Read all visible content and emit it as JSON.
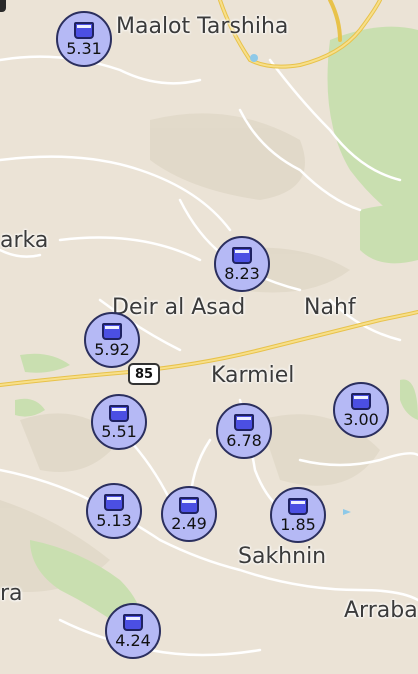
{
  "places": [
    {
      "id": "maalot-tarshiha",
      "text": "Maalot Tarshiha"
    },
    {
      "id": "arka",
      "text": "arka"
    },
    {
      "id": "deir-al-asad",
      "text": "Deir al Asad"
    },
    {
      "id": "nahf",
      "text": "Nahf"
    },
    {
      "id": "karmiel",
      "text": "Karmiel"
    },
    {
      "id": "sakhnin",
      "text": "Sakhnin"
    },
    {
      "id": "ra",
      "text": "ra"
    },
    {
      "id": "arraba",
      "text": "Arraba"
    }
  ],
  "road_shield": {
    "text": "85"
  },
  "markers": [
    {
      "value": "5.31"
    },
    {
      "value": "8.23"
    },
    {
      "value": "5.92"
    },
    {
      "value": "5.51"
    },
    {
      "value": "6.78"
    },
    {
      "value": "3.00"
    },
    {
      "value": "5.13"
    },
    {
      "value": "2.49"
    },
    {
      "value": "1.85"
    },
    {
      "value": "4.24"
    }
  ],
  "marker_icon": "water-cup-icon",
  "colors": {
    "land": "#ebe3d6",
    "road_major": "#f4d46a",
    "road_minor": "#ffffff",
    "forest": "#c9dfb0",
    "marker_fill": "#b5b9f5",
    "marker_border": "#2b2f5e"
  }
}
